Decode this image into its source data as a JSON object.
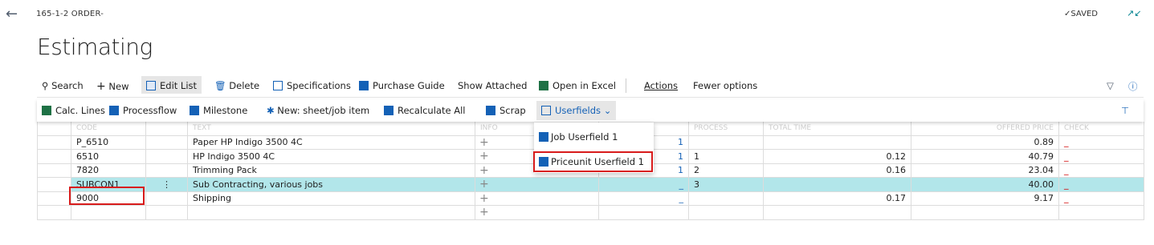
{
  "header": {
    "record_title": "165-1-2 ORDER-",
    "saved_label": "SAVED",
    "page_title": "Estimating"
  },
  "actions": {
    "search": "Search",
    "new": "New",
    "edit_list": "Edit List",
    "delete": "Delete",
    "specifications": "Specifications",
    "purchase_guide": "Purchase Guide",
    "show_attached": "Show Attached",
    "open_in_excel": "Open in Excel",
    "actions": "Actions",
    "fewer_options": "Fewer options"
  },
  "subactions": {
    "calc_lines": "Calc. Lines",
    "processflow": "Processflow",
    "milestone": "Milestone",
    "new_sheet": "New: sheet/job item",
    "recalculate_all": "Recalculate All",
    "scrap": "Scrap",
    "userfields": "Userfields"
  },
  "dropdown": {
    "items": [
      "Job Userfield 1",
      "Priceunit Userfield 1"
    ]
  },
  "rows": [
    {
      "code": "P_6510",
      "text": "Paper HP Indigo 3500 4C",
      "qty": "1",
      "process": "",
      "time": "",
      "price": "0.89",
      "flag": "_"
    },
    {
      "code": "6510",
      "text": "HP Indigo 3500 4C",
      "qty": "1",
      "process": "1",
      "time": "0.12",
      "price": "40.79",
      "flag": "_"
    },
    {
      "code": "7820",
      "text": "Trimming Pack",
      "qty": "1",
      "process": "2",
      "time": "0.16",
      "price": "23.04",
      "flag": "_"
    },
    {
      "code": "SUBCON1",
      "text": "Sub Contracting, various jobs",
      "qty": "_",
      "process": "3",
      "time": "",
      "price": "40.00",
      "flag": "_"
    },
    {
      "code": "9000",
      "text": "Shipping",
      "qty": "_",
      "process": "",
      "time": "0.17",
      "price": "9.17",
      "flag": "_"
    }
  ]
}
